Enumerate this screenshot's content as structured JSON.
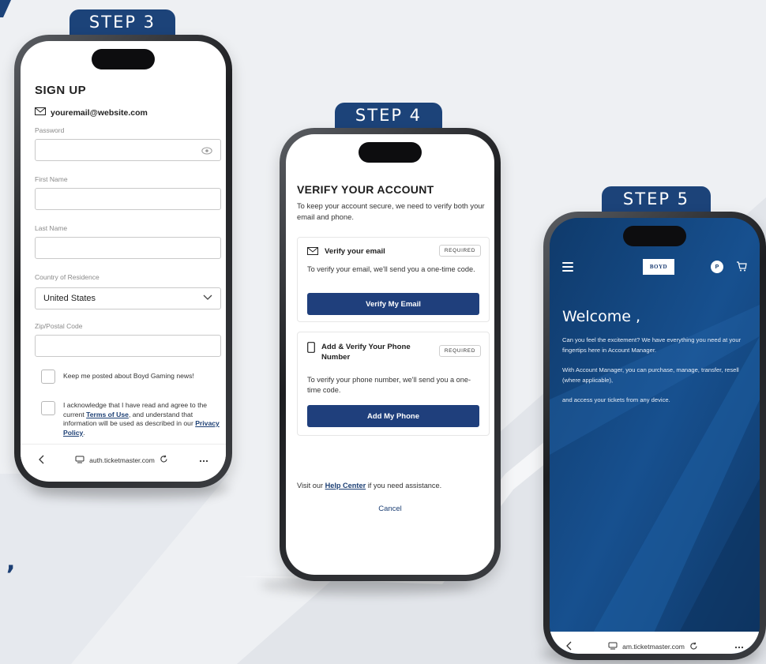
{
  "steps": {
    "step3": {
      "tab": "STEP 3",
      "title": "SIGN UP",
      "email": "youremail@website.com",
      "labels": {
        "password": "Password",
        "first_name": "First Name",
        "last_name": "Last Name",
        "country": "Country of Residence",
        "zip": "Zip/Postal Code"
      },
      "country_value": "United States",
      "checkbox_news": "Keep me posted about Boyd Gaming news!",
      "checkbox_terms_prefix": "I acknowledge that I have read and agree to the current ",
      "terms_link": "Terms of Use",
      "checkbox_terms_mid": ", and understand that information will be used as described in our ",
      "privacy_link": "Privacy Policy",
      "checkbox_terms_suffix": ".",
      "url": "auth.ticketmaster.com"
    },
    "step4": {
      "tab": "STEP 4",
      "title": "VERIFY YOUR ACCOUNT",
      "intro": "To keep your account secure, we need to verify both your email and phone.",
      "email_card": {
        "heading": "Verify your email",
        "badge": "REQUIRED",
        "description": "To verify your email, we'll send you a one-time code.",
        "button": "Verify My Email"
      },
      "phone_card": {
        "heading": "Add & Verify Your Phone Number",
        "badge": "REQUIRED",
        "description": "To verify your phone number, we'll send you a one-time code.",
        "button": "Add My Phone"
      },
      "help_prefix": "Visit our ",
      "help_link": "Help Center",
      "help_suffix": " if you need assistance.",
      "cancel": "Cancel"
    },
    "step5": {
      "tab": "STEP 5",
      "logo": "BOYD",
      "profile_initial": "P",
      "welcome": "Welcome ,",
      "para1": "Can you feel the excitement? We have everything you need at your fingertips here in Account Manager.",
      "para2": "With Account Manager, you can purchase, manage, transfer, resell (where applicable),",
      "para3": "and access your tickets from any device.",
      "url": "am.ticketmaster.com"
    }
  },
  "decor": {
    "quote_fragment": ","
  },
  "colors": {
    "brand_blue": "#1c4379",
    "button_blue": "#1f3f7c",
    "screen_blue": "#113d6f",
    "background": "#eef0f3"
  },
  "icons": [
    "envelope-icon",
    "eye-icon",
    "chevron-down-icon",
    "phone-icon",
    "back-icon",
    "tab-icon",
    "reload-icon",
    "more-icon",
    "menu-icon",
    "cart-icon"
  ]
}
